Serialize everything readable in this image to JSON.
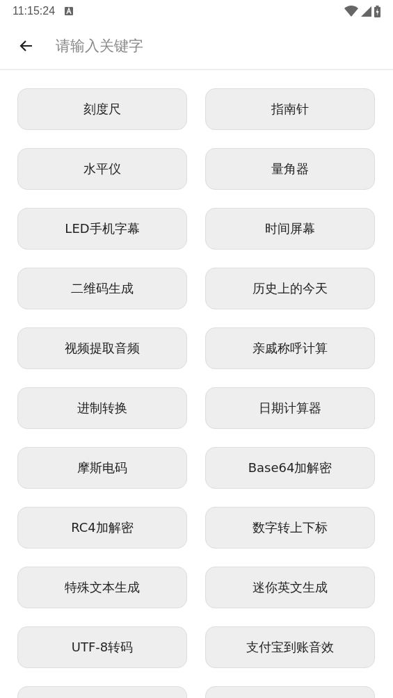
{
  "status_bar": {
    "time": "11:15:24"
  },
  "search": {
    "placeholder": "请输入关键字"
  },
  "tools": [
    {
      "kind": "full",
      "label": "刻度尺"
    },
    {
      "kind": "full",
      "label": "指南针"
    },
    {
      "kind": "full",
      "label": "水平仪"
    },
    {
      "kind": "full",
      "label": "量角器"
    },
    {
      "kind": "full",
      "label": "LED手机字幕"
    },
    {
      "kind": "full",
      "label": "时间屏幕"
    },
    {
      "kind": "full",
      "label": "二维码生成"
    },
    {
      "kind": "full",
      "label": "历史上的今天"
    },
    {
      "kind": "full",
      "label": "视频提取音频"
    },
    {
      "kind": "full",
      "label": "亲戚称呼计算"
    },
    {
      "kind": "full",
      "label": "进制转换"
    },
    {
      "kind": "full",
      "label": "日期计算器"
    },
    {
      "kind": "full",
      "label": "摩斯电码"
    },
    {
      "kind": "full",
      "label": "Base64加解密"
    },
    {
      "kind": "full",
      "label": "RC4加解密"
    },
    {
      "kind": "full",
      "label": "数字转上下标"
    },
    {
      "kind": "full",
      "label": "特殊文本生成"
    },
    {
      "kind": "full",
      "label": "迷你英文生成"
    },
    {
      "kind": "full",
      "label": "UTF-8转码"
    },
    {
      "kind": "full",
      "label": "支付宝到账音效"
    },
    {
      "kind": "cut"
    },
    {
      "kind": "cut"
    }
  ]
}
